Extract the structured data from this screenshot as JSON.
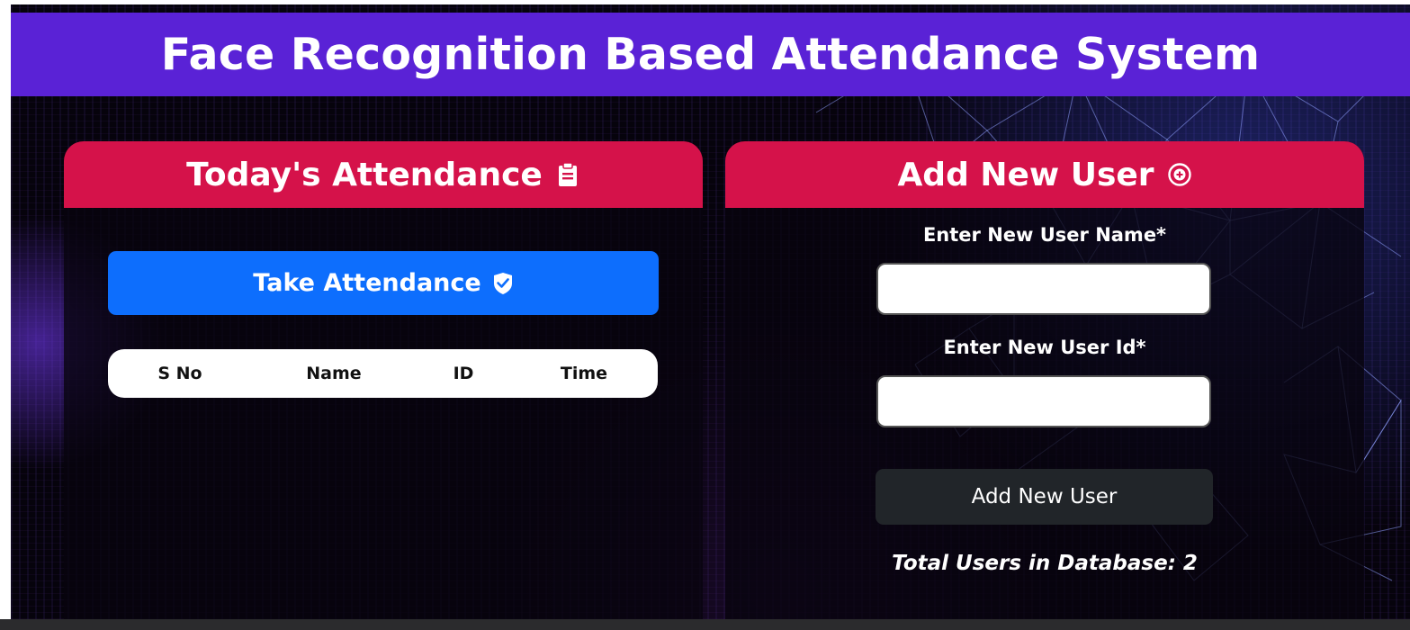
{
  "header": {
    "title": "Face Recognition Based Attendance System"
  },
  "attendance_panel": {
    "title": "Today's Attendance",
    "title_icon": "clipboard-icon",
    "take_button_label": "Take Attendance",
    "take_button_icon": "shield-check-icon",
    "table": {
      "columns": [
        "S No",
        "Name",
        "ID",
        "Time"
      ],
      "rows": []
    }
  },
  "add_user_panel": {
    "title": "Add New User",
    "title_icon": "plus-circle-icon",
    "name_label": "Enter New User Name*",
    "name_value": "",
    "id_label": "Enter New User Id*",
    "id_value": "",
    "submit_label": "Add New User",
    "total_users_text": "Total Users in Database: 2"
  },
  "colors": {
    "header_bg": "#5a22d6",
    "panel_head_bg": "#d5124a",
    "primary_button": "#0d6efd",
    "dark_button": "#212529"
  }
}
